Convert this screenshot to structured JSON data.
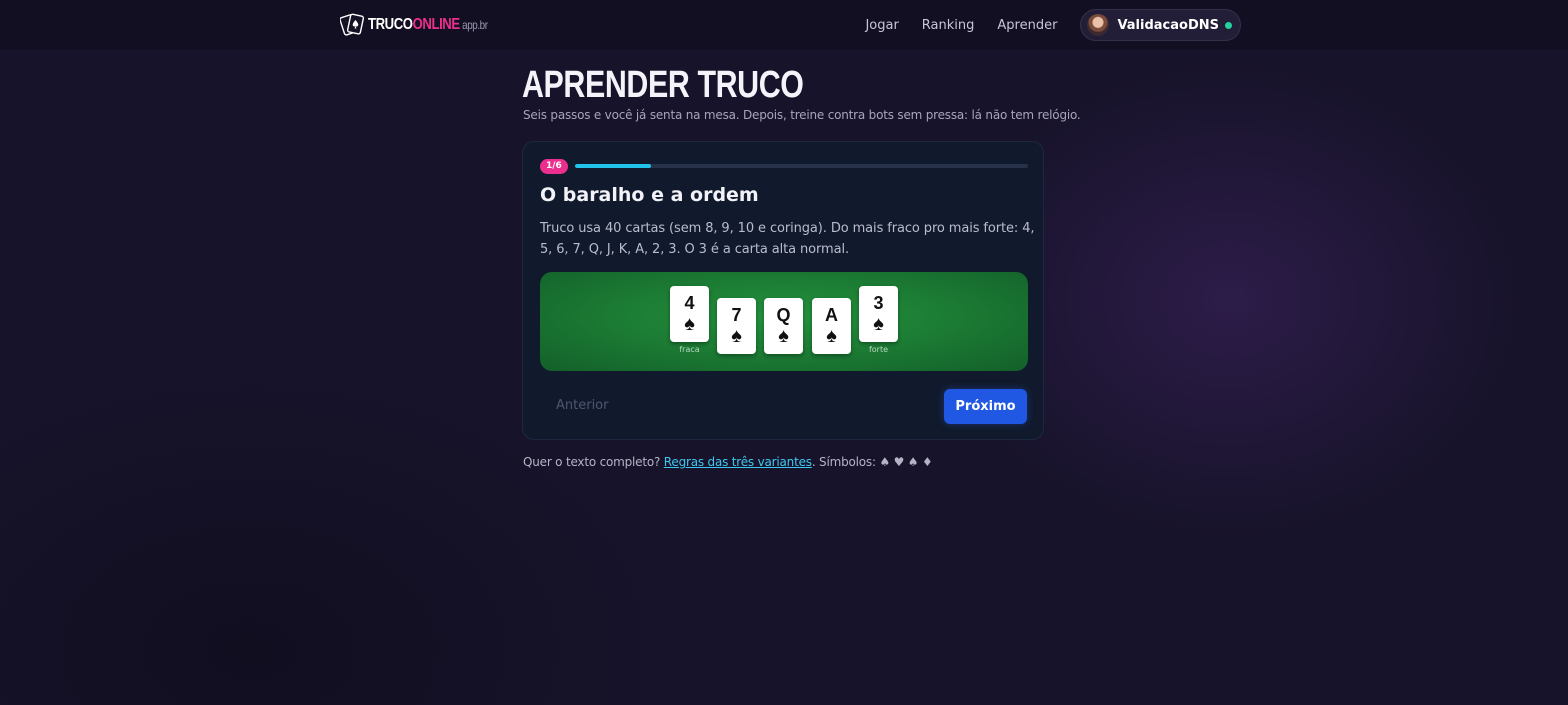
{
  "header": {
    "logo": {
      "part1": "TRUCO",
      "part2": "ONLINE",
      "domain": "app.br"
    },
    "nav": [
      "Jogar",
      "Ranking",
      "Aprender"
    ],
    "user": {
      "name": "ValidacaoDNS",
      "status": "online"
    }
  },
  "page": {
    "title": "APRENDER TRUCO",
    "subtitle": "Seis passos e você já senta na mesa. Depois, treine contra bots sem pressa: lá não tem relógio."
  },
  "lesson": {
    "step_label": "1/6",
    "progress_fraction": 0.1667,
    "title": "O baralho e a ordem",
    "text": "Truco usa 40 cartas (sem 8, 9, 10 e coringa). Do mais fraco pro mais forte: 4, 5, 6, 7, Q, J, K, A, 2, 3. O 3 é a carta alta normal.",
    "cards": [
      {
        "rank": "4",
        "suit": "♠",
        "caption": "fraca"
      },
      {
        "rank": "7",
        "suit": "♠",
        "caption": ""
      },
      {
        "rank": "Q",
        "suit": "♠",
        "caption": ""
      },
      {
        "rank": "A",
        "suit": "♠",
        "caption": ""
      },
      {
        "rank": "3",
        "suit": "♠",
        "caption": "forte"
      }
    ],
    "prev_label": "Anterior",
    "next_label": "Próximo"
  },
  "footer": {
    "prefix": "Quer o texto completo? ",
    "link": "Regras das três variantes",
    "suffix": ". Símbolos: ♠ ♥ ♠ ♦"
  },
  "colors": {
    "accent_pink": "#ec2f8e",
    "progress_cyan": "#21c3ea",
    "button_blue": "#2058e4",
    "felt_green": "#1c7d34",
    "online_green": "#22d3a0"
  },
  "icons": {
    "logo": "playing-cards-icon",
    "user_status": "online-dot-icon"
  }
}
